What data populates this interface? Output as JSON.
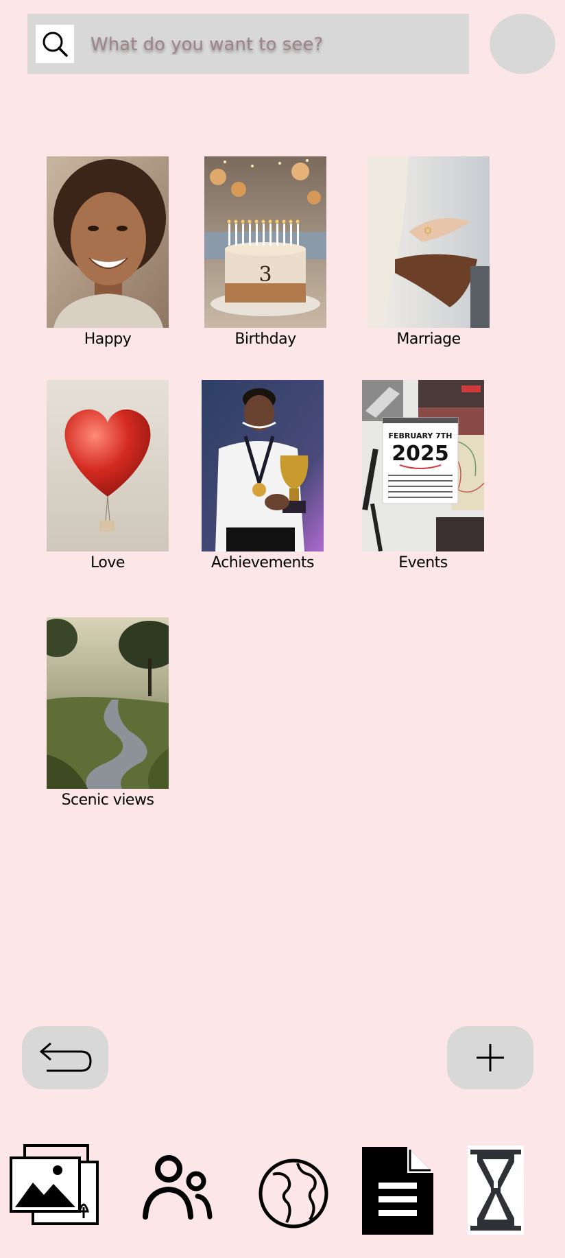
{
  "search": {
    "placeholder": "What do you want to see?"
  },
  "albums": [
    {
      "label": "Happy"
    },
    {
      "label": "Birthday"
    },
    {
      "label": "Marriage"
    },
    {
      "label": "Love"
    },
    {
      "label": "Achievements"
    },
    {
      "label": "Events"
    },
    {
      "label": "Scenic views"
    }
  ],
  "events_thumb": {
    "month_day": "FEBRUARY 7TH",
    "year": "2025"
  },
  "birthday_thumb": {
    "cake_number": "3"
  },
  "actions": {
    "back_icon": "undo-arrow-icon",
    "add_icon": "plus-icon"
  },
  "bottom_nav": [
    {
      "icon": "gallery-icon"
    },
    {
      "icon": "people-icon"
    },
    {
      "icon": "globe-icon"
    },
    {
      "icon": "document-icon"
    },
    {
      "icon": "hourglass-icon"
    }
  ],
  "colors": {
    "background": "#fde6e8",
    "control_gray": "#d8d8d8"
  }
}
